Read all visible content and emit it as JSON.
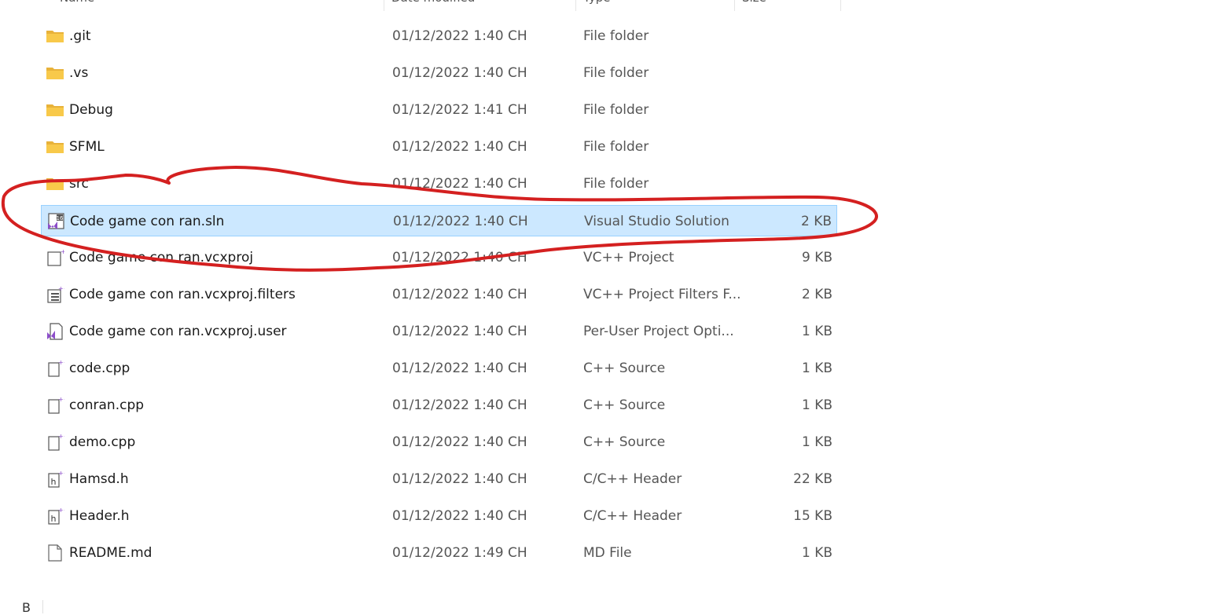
{
  "columns": {
    "name": "Name",
    "date_modified": "Date modified",
    "type": "Type",
    "size": "Size"
  },
  "files": [
    {
      "name": ".git",
      "date": "01/12/2022 1:40 CH",
      "type": "File folder",
      "size": "",
      "icon": "folder-icon",
      "selected": false
    },
    {
      "name": ".vs",
      "date": "01/12/2022 1:40 CH",
      "type": "File folder",
      "size": "",
      "icon": "folder-icon",
      "selected": false
    },
    {
      "name": "Debug",
      "date": "01/12/2022 1:41 CH",
      "type": "File folder",
      "size": "",
      "icon": "folder-icon",
      "selected": false
    },
    {
      "name": "SFML",
      "date": "01/12/2022 1:40 CH",
      "type": "File folder",
      "size": "",
      "icon": "folder-icon",
      "selected": false
    },
    {
      "name": "src",
      "date": "01/12/2022 1:40 CH",
      "type": "File folder",
      "size": "",
      "icon": "folder-icon",
      "selected": false
    },
    {
      "name": "Code game con ran.sln",
      "date": "01/12/2022 1:40 CH",
      "type": "Visual Studio Solution",
      "size": "2 KB",
      "icon": "vs-solution-icon",
      "selected": true
    },
    {
      "name": "Code game con ran.vcxproj",
      "date": "01/12/2022 1:40 CH",
      "type": "VC++ Project",
      "size": "9 KB",
      "icon": "vcxproj-icon",
      "selected": false
    },
    {
      "name": "Code game con ran.vcxproj.filters",
      "date": "01/12/2022 1:40 CH",
      "type": "VC++ Project Filters F...",
      "size": "2 KB",
      "icon": "vcxproj-filters-icon",
      "selected": false
    },
    {
      "name": "Code game con ran.vcxproj.user",
      "date": "01/12/2022 1:40 CH",
      "type": "Per-User Project Opti...",
      "size": "1 KB",
      "icon": "vs-user-icon",
      "selected": false
    },
    {
      "name": "code.cpp",
      "date": "01/12/2022 1:40 CH",
      "type": "C++ Source",
      "size": "1 KB",
      "icon": "cpp-file-icon",
      "selected": false
    },
    {
      "name": "conran.cpp",
      "date": "01/12/2022 1:40 CH",
      "type": "C++ Source",
      "size": "1 KB",
      "icon": "cpp-file-icon",
      "selected": false
    },
    {
      "name": "demo.cpp",
      "date": "01/12/2022 1:40 CH",
      "type": "C++ Source",
      "size": "1 KB",
      "icon": "cpp-file-icon",
      "selected": false
    },
    {
      "name": "Hamsd.h",
      "date": "01/12/2022 1:40 CH",
      "type": "C/C++ Header",
      "size": "22 KB",
      "icon": "header-file-icon",
      "selected": false
    },
    {
      "name": "Header.h",
      "date": "01/12/2022 1:40 CH",
      "type": "C/C++ Header",
      "size": "15 KB",
      "icon": "header-file-icon",
      "selected": false
    },
    {
      "name": "README.md",
      "date": "01/12/2022 1:49 CH",
      "type": "MD File",
      "size": "1 KB",
      "icon": "blank-file-icon",
      "selected": false
    }
  ],
  "status_bar": {
    "text": "B"
  },
  "colors": {
    "selection_bg": "#cce8ff",
    "selection_border": "#99d1ff",
    "annotation": "#d42020",
    "folder": "#f8c94a"
  }
}
